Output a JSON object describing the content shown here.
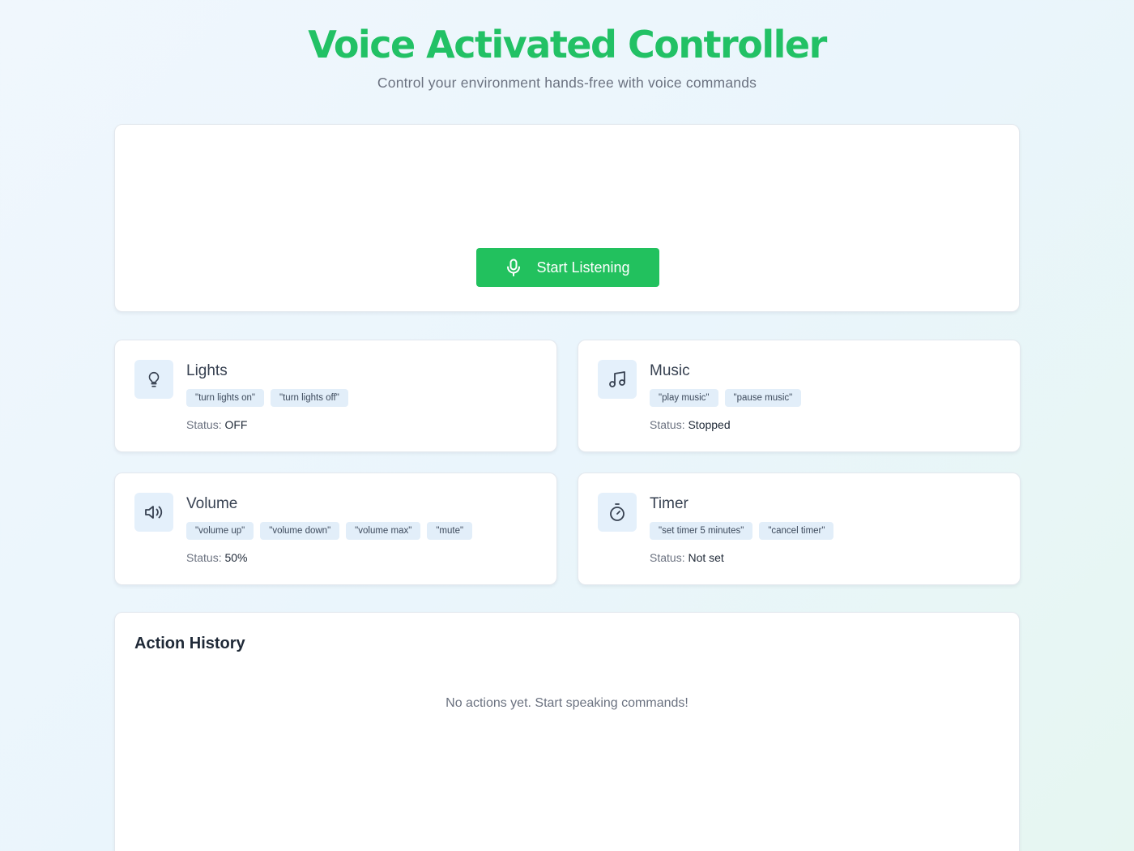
{
  "header": {
    "title": "Voice Activated Controller",
    "subtitle": "Control your environment hands-free with voice commands"
  },
  "listen": {
    "button_label": "Start Listening",
    "icon": "microphone-icon"
  },
  "status_prefix": "Status: ",
  "devices": [
    {
      "name": "Lights",
      "icon": "lightbulb-icon",
      "commands": [
        "\"turn lights on\"",
        "\"turn lights off\""
      ],
      "status": "OFF"
    },
    {
      "name": "Music",
      "icon": "music-note-icon",
      "commands": [
        "\"play music\"",
        "\"pause music\""
      ],
      "status": "Stopped"
    },
    {
      "name": "Volume",
      "icon": "speaker-icon",
      "commands": [
        "\"volume up\"",
        "\"volume down\"",
        "\"volume max\"",
        "\"mute\""
      ],
      "status": "50%"
    },
    {
      "name": "Timer",
      "icon": "stopwatch-icon",
      "commands": [
        "\"set timer 5 minutes\"",
        "\"cancel timer\""
      ],
      "status": "Not set"
    }
  ],
  "history": {
    "title": "Action History",
    "empty_text": "No actions yet. Start speaking commands!"
  },
  "colors": {
    "accent": "#22c15e",
    "chip_bg": "#e2eef9",
    "icon_bg": "#e4f0fb"
  }
}
